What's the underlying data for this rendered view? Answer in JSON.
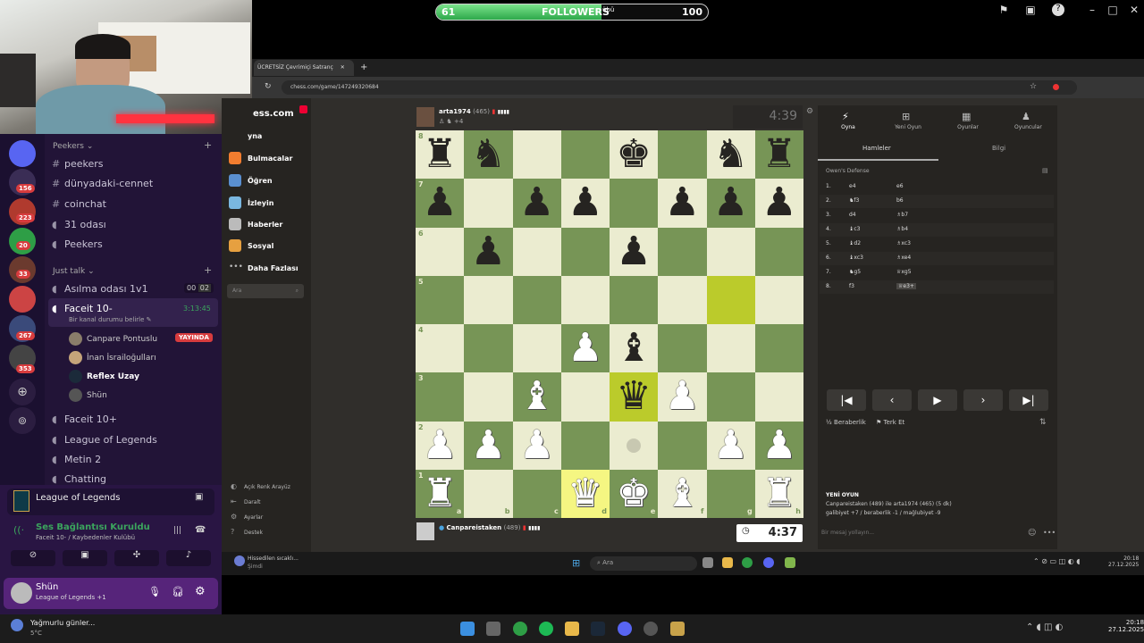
{
  "followers": {
    "current": "61",
    "label": "FOLLOWERS",
    "target": "100",
    "sub": "übü",
    "progress": 0.61
  },
  "browser": {
    "tab_title": "ÜCRETSİZ Çevrimiçi Satranç",
    "url": "chess.com/game/147249320684"
  },
  "chess_nav": {
    "logo": "ess.com",
    "items": [
      "yna",
      "Bulmacalar",
      "Öğren",
      "İzleyin",
      "Haberler",
      "Sosyal",
      "Daha Fazlası"
    ],
    "search_placeholder": "Ara",
    "bottom": [
      "Açık Renk Arayüz",
      "Daralt",
      "Ayarlar",
      "Destek"
    ]
  },
  "top_player": {
    "name": "arta1974",
    "rating": "(465)",
    "clock": "4:39",
    "extra": "+4"
  },
  "bottom_player": {
    "name": "Canpareistaken",
    "rating": "(489)",
    "clock": "4:37"
  },
  "board": {
    "ranks": [
      "8",
      "7",
      "6",
      "5",
      "4",
      "3",
      "2",
      "1"
    ],
    "files": [
      "a",
      "b",
      "c",
      "d",
      "e",
      "f",
      "g",
      "h"
    ],
    "position": [
      [
        "bR",
        "bN",
        "",
        "",
        "bK",
        "",
        "bN",
        "bR"
      ],
      [
        "bP",
        "",
        "bP",
        "bP",
        "",
        "bP",
        "bP",
        "bP"
      ],
      [
        "",
        "bP",
        "",
        "",
        "bP",
        "",
        "",
        ""
      ],
      [
        "",
        "",
        "",
        "",
        "",
        "",
        "",
        ""
      ],
      [
        "",
        "",
        "",
        "wP",
        "bB",
        "",
        "",
        ""
      ],
      [
        "",
        "",
        "wB",
        "",
        "bQ",
        "wP",
        "",
        ""
      ],
      [
        "wP",
        "wP",
        "wP",
        "",
        "",
        "",
        "wP",
        "wP"
      ],
      [
        "wR",
        "",
        "",
        "wQ",
        "wK",
        "wB",
        "",
        "wR"
      ]
    ]
  },
  "panel": {
    "tabs": [
      "Oyna",
      "Yeni Oyun",
      "Oyunlar",
      "Oyuncular"
    ],
    "subtabs": [
      "Hamleler",
      "Bilgi"
    ],
    "opening": "Owen's Defense",
    "moves": [
      [
        "1.",
        "e4",
        "e6"
      ],
      [
        "2.",
        "♞f3",
        "b6"
      ],
      [
        "3.",
        "d4",
        "♗b7"
      ],
      [
        "4.",
        "♝c3",
        "♗b4"
      ],
      [
        "5.",
        "♝d2",
        "♗xc3"
      ],
      [
        "6.",
        "♝xc3",
        "♗xe4"
      ],
      [
        "7.",
        "♞g5",
        "♕xg5"
      ],
      [
        "8.",
        "f3",
        "♕e3+"
      ]
    ],
    "draw": "Beraberlik",
    "resign": "Terk Et",
    "new_game": "YENİ OYUN",
    "result_line1": "Canpareistaken (489) ile arta1974 (465) (5 dk)",
    "result_line2": "galibiyet +7 / beraberlik -1 / mağlubiyet -9",
    "chat_placeholder": "Bir mesaj yollayın..."
  },
  "discord": {
    "categories": [
      "Peekers",
      "Just talk"
    ],
    "text_channels": [
      "peekers",
      "dünyadaki-cennet",
      "coinchat"
    ],
    "voice_channels": [
      "31 odası",
      "Peekers"
    ],
    "just_talk": [
      {
        "name": "Asılma odası 1v1",
        "badge1": "00",
        "badge2": "02"
      },
      {
        "name": "Faceit 10-",
        "time": "3:13:45",
        "status": "Bir kanal durumu belirle"
      }
    ],
    "voice_users": [
      {
        "name": "Canpare Pontuslu",
        "badge": "YAYINDA"
      },
      {
        "name": "İnan İsrailoğulları"
      },
      {
        "name": "Reflex Uzay"
      },
      {
        "name": "Shün"
      }
    ],
    "more_channels": [
      "Faceit 10+",
      "League of Legends",
      "Metin 2",
      "Chatting"
    ],
    "server_badges": [
      "156",
      "223",
      "20",
      "33",
      "267",
      "353"
    ],
    "activity": "League of Legends",
    "connection": "Ses Bağlantısı Kuruldu",
    "connection_sub": "Faceit 10- / Kaybedenler Kulübü",
    "user": "Shün",
    "user_status": "League of Legends +1"
  },
  "taskbar_inner": {
    "weather": "Hissedilen sıcaklı...",
    "weather2": "Şimdi",
    "search": "Ara",
    "time": "20:18",
    "date": "27.12.2025"
  },
  "taskbar": {
    "weather": "Yağmurlu günler...",
    "temp": "5°C",
    "time": "20:18",
    "date": "27.12.2025"
  },
  "colors": {
    "board_light": "#ebecd0",
    "board_dark": "#779556",
    "highlight": "#f5f682",
    "discord_bg": "#221437"
  }
}
